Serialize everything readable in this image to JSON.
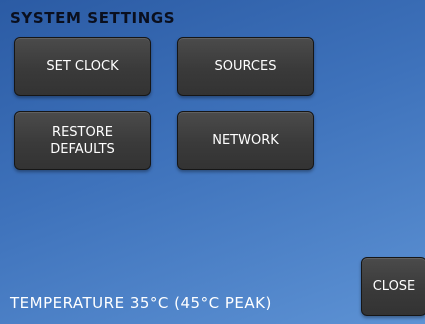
{
  "screen": {
    "title": "SYSTEM SETTINGS",
    "temperature_text": "TEMPERATURE 35°C (45°C PEAK)"
  },
  "buttons": {
    "set_clock": "SET CLOCK",
    "sources": "SOURCES",
    "restore_defaults_line1": "RESTORE",
    "restore_defaults_line2": "DEFAULTS",
    "network": "NETWORK",
    "close": "CLOSE"
  },
  "colors": {
    "background_top": "#2b5ba4",
    "background_bottom": "#5d92d4",
    "button": "#3d3d3d",
    "title_text": "#0a0f1e",
    "button_text": "#ffffff"
  }
}
